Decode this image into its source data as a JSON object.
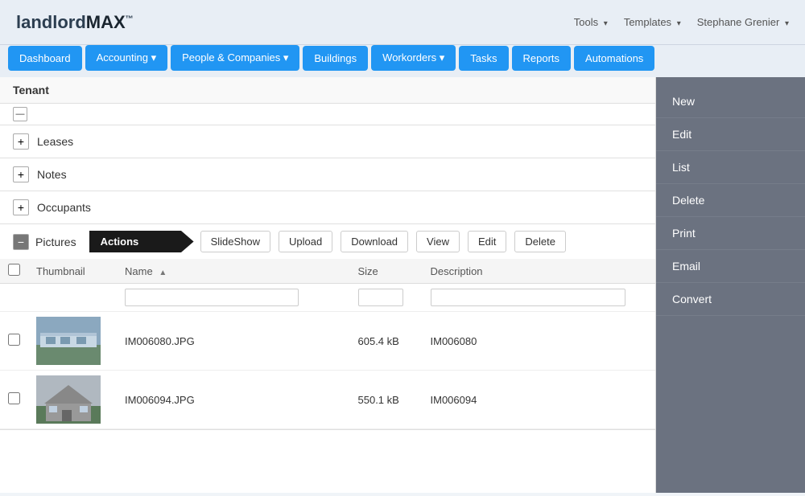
{
  "header": {
    "logo_landlord": "landlord",
    "logo_max": "MAX",
    "logo_tm": "™",
    "tools_label": "Tools",
    "templates_label": "Templates",
    "user_label": "Stephane Grenier"
  },
  "navbar": {
    "items": [
      {
        "id": "dashboard",
        "label": "Dashboard",
        "style": "active"
      },
      {
        "id": "accounting",
        "label": "Accounting",
        "style": "dropdown",
        "arrow": true
      },
      {
        "id": "people",
        "label": "People & Companies",
        "style": "dropdown",
        "arrow": true
      },
      {
        "id": "buildings",
        "label": "Buildings",
        "style": "active"
      },
      {
        "id": "workorders",
        "label": "Workorders",
        "style": "dropdown",
        "arrow": true
      },
      {
        "id": "tasks",
        "label": "Tasks",
        "style": "active"
      },
      {
        "id": "reports",
        "label": "Reports",
        "style": "active"
      },
      {
        "id": "automations",
        "label": "Automations",
        "style": "active"
      }
    ]
  },
  "content": {
    "tenant_label": "Tenant",
    "sections": [
      {
        "id": "leases",
        "label": "Leases",
        "toggle": "+"
      },
      {
        "id": "notes",
        "label": "Notes",
        "toggle": "+"
      },
      {
        "id": "occupants",
        "label": "Occupants",
        "toggle": "+"
      }
    ],
    "pictures": {
      "toggle": "-",
      "label": "Pictures",
      "actions_label": "Actions",
      "buttons": [
        {
          "id": "slideshow",
          "label": "SlideShow"
        },
        {
          "id": "upload",
          "label": "Upload"
        },
        {
          "id": "download",
          "label": "Download"
        },
        {
          "id": "view",
          "label": "View"
        },
        {
          "id": "edit",
          "label": "Edit"
        },
        {
          "id": "delete",
          "label": "Delete"
        }
      ],
      "columns": [
        {
          "id": "checkbox",
          "label": ""
        },
        {
          "id": "thumbnail",
          "label": "Thumbnail"
        },
        {
          "id": "name",
          "label": "Name",
          "sortable": true
        },
        {
          "id": "size",
          "label": "Size"
        },
        {
          "id": "description",
          "label": "Description"
        }
      ],
      "rows": [
        {
          "id": "row1",
          "thumbnail_alt": "house exterior 1",
          "name": "IM006080.JPG",
          "size": "605.4 kB",
          "description": "IM006080"
        },
        {
          "id": "row2",
          "thumbnail_alt": "house exterior 2",
          "name": "IM006094.JPG",
          "size": "550.1 kB",
          "description": "IM006094"
        }
      ]
    }
  },
  "right_menu": {
    "items": [
      {
        "id": "new",
        "label": "New"
      },
      {
        "id": "edit",
        "label": "Edit"
      },
      {
        "id": "list",
        "label": "List"
      },
      {
        "id": "delete",
        "label": "Delete"
      },
      {
        "id": "print",
        "label": "Print"
      },
      {
        "id": "email",
        "label": "Email"
      },
      {
        "id": "convert",
        "label": "Convert"
      }
    ]
  }
}
